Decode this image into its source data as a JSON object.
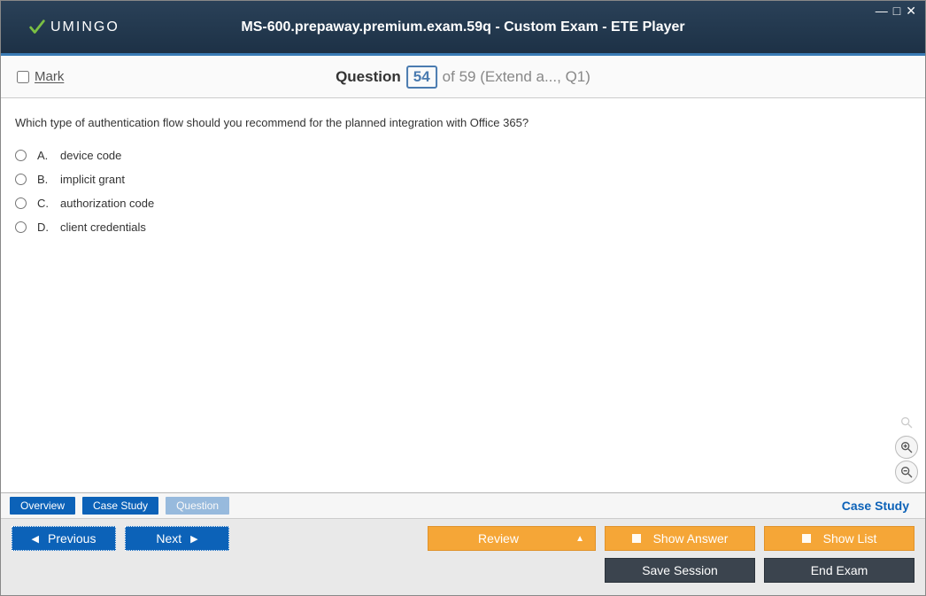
{
  "window": {
    "brand": "UMINGO",
    "title": "MS-600.prepaway.premium.exam.59q - Custom Exam - ETE Player"
  },
  "header": {
    "mark_label": "Mark",
    "question_label": "Question",
    "current_number": "54",
    "of_label": "of 59 (Extend a..., Q1)"
  },
  "question": {
    "text": "Which type of authentication flow should you recommend for the planned integration with Office 365?",
    "options": [
      {
        "letter": "A.",
        "text": "device code"
      },
      {
        "letter": "B.",
        "text": "implicit grant"
      },
      {
        "letter": "C.",
        "text": "authorization code"
      },
      {
        "letter": "D.",
        "text": "client credentials"
      }
    ]
  },
  "tabs": {
    "overview": "Overview",
    "case_study": "Case Study",
    "question": "Question",
    "right_label": "Case Study"
  },
  "buttons": {
    "previous": "Previous",
    "next": "Next",
    "review": "Review",
    "show_answer": "Show Answer",
    "show_list": "Show List",
    "save_session": "Save Session",
    "end_exam": "End Exam"
  }
}
